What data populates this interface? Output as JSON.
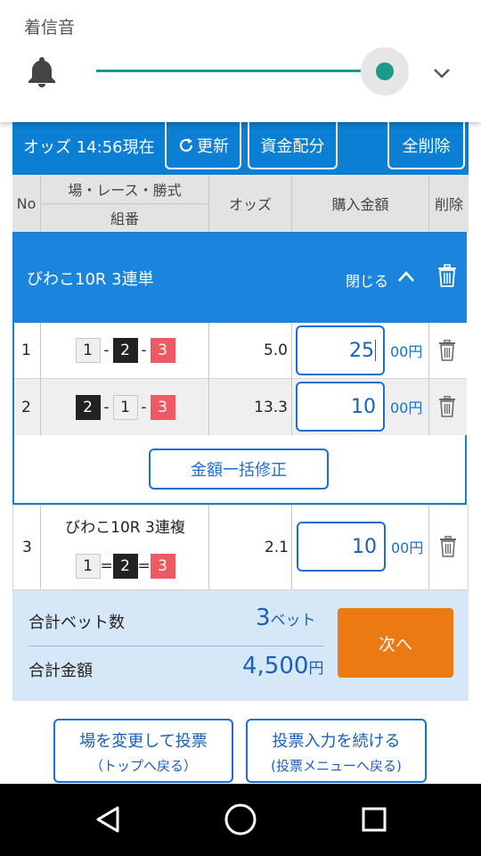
{
  "volume": {
    "title": "着信音",
    "icon": "bell-icon",
    "expand_icon": "chevron-down-icon",
    "level": 0.95,
    "accent": "#1a9a8a"
  },
  "header": {
    "odds_time": "オッズ 14:56現在",
    "refresh_label": "更新",
    "allocate_label": "資金配分",
    "delete_all_label": "全削除"
  },
  "table_header": {
    "no": "No",
    "venue_race_type": "場・レース・勝式",
    "combination": "組番",
    "odds": "オッズ",
    "amount": "購入金額",
    "delete": "削除"
  },
  "group": {
    "title": "びわこ10R 3連単",
    "close_label": "閉じる",
    "bulk_edit_label": "金額一括修正",
    "rows": [
      {
        "no": "1",
        "c1": "1",
        "s1": "-",
        "c2": "2",
        "s2": "-",
        "c3": "3",
        "odds": "5.0",
        "amount": "25",
        "unit": "00円"
      },
      {
        "no": "2",
        "c1": "2",
        "s1": "-",
        "c2": "1",
        "s2": "-",
        "c3": "3",
        "odds": "13.3",
        "amount": "10",
        "unit": "00円"
      }
    ]
  },
  "single": {
    "no": "3",
    "title": "びわこ10R 3連複",
    "c1": "1",
    "s1": "=",
    "c2": "2",
    "s2": "=",
    "c3": "3",
    "odds": "2.1",
    "amount": "10",
    "unit": "00円"
  },
  "summary": {
    "bet_count_label": "合計ベット数",
    "bet_count": "3",
    "bet_unit": "ベット",
    "total_label": "合計金額",
    "total": "4,500",
    "total_unit": "円",
    "next_label": "次へ"
  },
  "bottom": {
    "change_venue": "場を変更して投票",
    "change_venue_sub": "（トップへ戻る）",
    "continue": "投票入力を続ける",
    "continue_sub": "(投票メニューへ戻る)"
  },
  "colors": {
    "primary": "#0a7fd3",
    "accent": "#ec7a12",
    "summary_bg": "#d6e8f8"
  }
}
